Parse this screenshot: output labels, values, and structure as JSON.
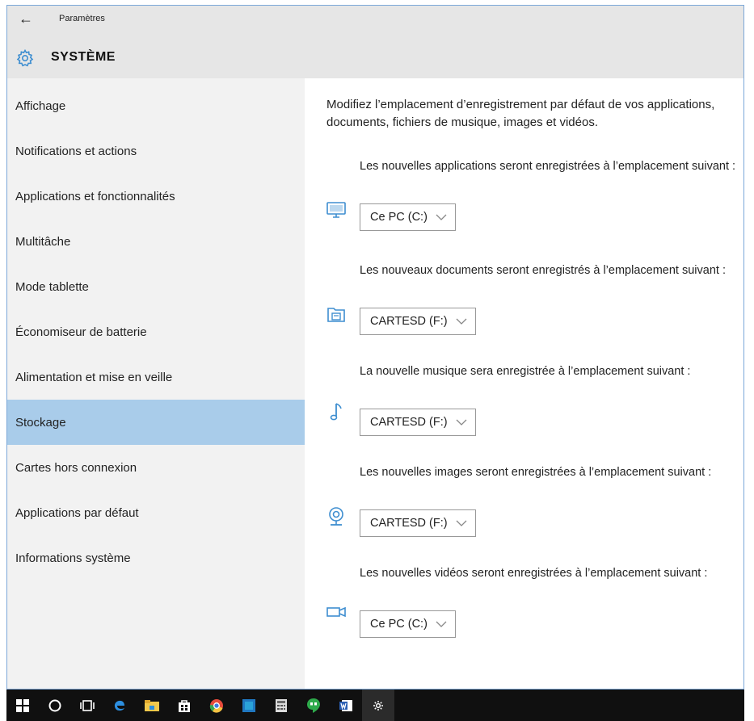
{
  "window": {
    "app_title": "Paramètres",
    "section_title": "SYSTÈME"
  },
  "sidebar": {
    "selected_index": 7,
    "items": [
      {
        "label": "Affichage"
      },
      {
        "label": "Notifications et actions"
      },
      {
        "label": "Applications et fonctionnalités"
      },
      {
        "label": "Multitâche"
      },
      {
        "label": "Mode tablette"
      },
      {
        "label": "Économiseur de batterie"
      },
      {
        "label": "Alimentation et mise en veille"
      },
      {
        "label": "Stockage"
      },
      {
        "label": "Cartes hors connexion"
      },
      {
        "label": "Applications par défaut"
      },
      {
        "label": "Informations système"
      }
    ]
  },
  "content": {
    "intro": "Modifiez l’emplacement d’enregistrement par défaut de vos applications, documents, fichiers de musique, images et vidéos.",
    "groups": [
      {
        "label": "Les nouvelles applications seront enregistrées à l’emplacement suivant :",
        "value": "Ce PC (C:)",
        "icon": "monitor-icon"
      },
      {
        "label": "Les nouveaux documents seront enregistrés à l’emplacement suivant :",
        "value": "CARTESD (F:)",
        "icon": "documents-icon"
      },
      {
        "label": "La nouvelle musique sera enregistrée à l’emplacement suivant :",
        "value": "CARTESD (F:)",
        "icon": "music-icon"
      },
      {
        "label": "Les nouvelles images seront enregistrées à l’emplacement suivant :",
        "value": "CARTESD (F:)",
        "icon": "webcam-icon"
      },
      {
        "label": "Les nouvelles vidéos seront enregistrées à l’emplacement suivant :",
        "value": "Ce PC (C:)",
        "icon": "video-camera-icon"
      }
    ]
  },
  "taskbar": {
    "icons": [
      "windows-start-icon",
      "search-circle-icon",
      "task-view-icon",
      "edge-icon",
      "file-explorer-icon",
      "store-icon",
      "chrome-icon",
      "app-icon",
      "calculator-icon",
      "hangouts-icon",
      "word-icon",
      "settings-icon"
    ]
  },
  "colors": {
    "accent": "#3e8ed0",
    "selected_bg": "#a9ccea",
    "sidebar_bg": "#f2f2f2",
    "header_bg": "#e6e6e6",
    "taskbar_bg": "#101010"
  }
}
